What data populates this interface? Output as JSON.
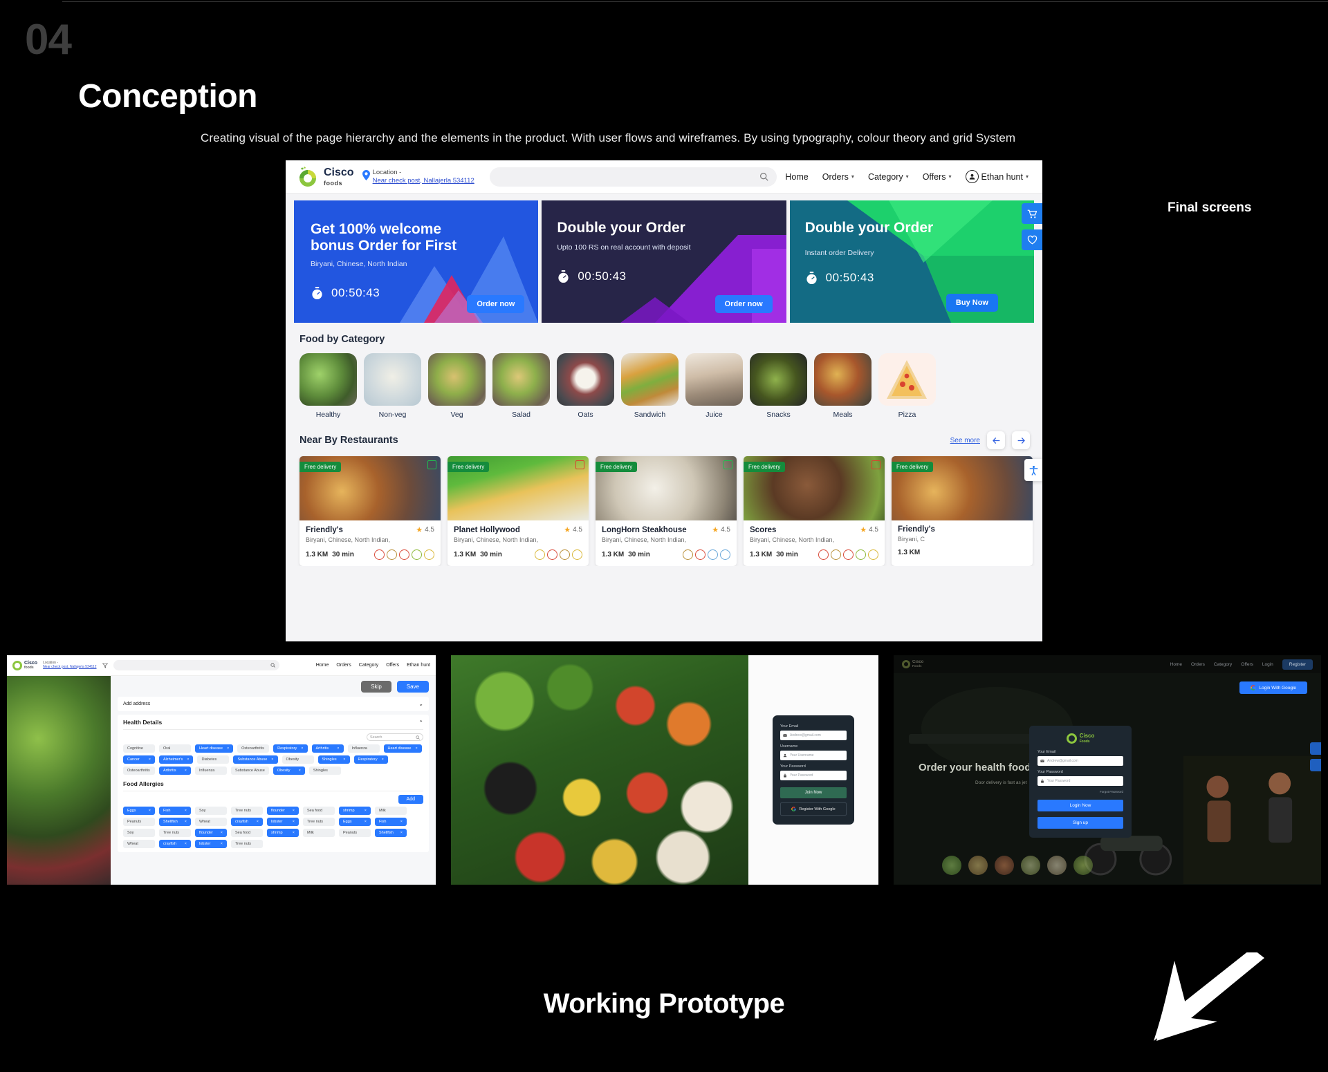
{
  "section": {
    "number": "04",
    "title": "Conception",
    "subtitle": "Creating visual of  the page hierarchy and the elements in the product. With user flows and wireframes. By using typography, colour theory and grid System",
    "final_screens_label": "Final screens",
    "footer_title": "Working Prototype"
  },
  "app": {
    "brand": {
      "name": "Cisco",
      "sub": "foods"
    },
    "location": {
      "label": "Location -",
      "value": "Near check post, Nallajerla  534112"
    },
    "search_placeholder": "",
    "nav": [
      {
        "label": "Home",
        "caret": false
      },
      {
        "label": "Orders",
        "caret": true
      },
      {
        "label": "Category",
        "caret": true
      },
      {
        "label": "Offers",
        "caret": true
      }
    ],
    "user": {
      "name": "Ethan hunt"
    }
  },
  "banners": [
    {
      "title": "Get 100% welcome bonus Order for First",
      "subtitle": "Biryani, Chinese, North Indian",
      "timer": "00:50:43",
      "cta": "Order now",
      "color": "#2256e0"
    },
    {
      "title": "Double your Order",
      "subtitle": "Upto 100 RS on real account with deposit",
      "timer": "00:50:43",
      "cta": "Order now",
      "color": "#272548"
    },
    {
      "title": "Double your Order",
      "subtitle": "Instant order Delivery",
      "timer": "00:50:43",
      "cta": "Buy Now",
      "color": "#136b84"
    }
  ],
  "category_section": {
    "heading": "Food by Category",
    "items": [
      {
        "label": "Healthy"
      },
      {
        "label": "Non-veg"
      },
      {
        "label": "Veg"
      },
      {
        "label": "Salad"
      },
      {
        "label": "Oats"
      },
      {
        "label": "Sandwich"
      },
      {
        "label": "Juice"
      },
      {
        "label": "Snacks"
      },
      {
        "label": "Meals"
      },
      {
        "label": "Pizza"
      }
    ]
  },
  "nearby": {
    "heading": "Near By Restaurants",
    "see_more": "See more",
    "restaurants": [
      {
        "badge": "Free delivery",
        "name": "Friendly's",
        "tags": "Biryani, Chinese, North Indian,",
        "distance": "1.3 KM",
        "time": "30 min",
        "rating": "4.5"
      },
      {
        "badge": "Free delivery",
        "name": "Planet Hollywood",
        "tags": "Biryani, Chinese, North Indian,",
        "distance": "1.3 KM",
        "time": "30 min",
        "rating": "4.5"
      },
      {
        "badge": "Free delivery",
        "name": "LongHorn Steakhouse",
        "tags": "Biryani, Chinese, North Indian,",
        "distance": "1.3 KM",
        "time": "30 min",
        "rating": "4.5"
      },
      {
        "badge": "Free delivery",
        "name": "Scores",
        "tags": "Biryani, Chinese, North Indian,",
        "distance": "1.3 KM",
        "time": "30 min",
        "rating": "4.5"
      },
      {
        "badge": "Free delivery",
        "name": "Friendly's",
        "tags": "Biryani, C",
        "distance": "1.3 KM",
        "time": "",
        "rating": ""
      }
    ]
  },
  "health_screen": {
    "skip": "Skip",
    "save": "Save",
    "add_address": "Add address",
    "health_details": "Health Details",
    "search_placeholder": "Search",
    "add_button": "Add",
    "food_allergies": "Food Allergies",
    "health_chips": [
      {
        "label": "Cognitive",
        "on": false
      },
      {
        "label": "Oral",
        "on": false
      },
      {
        "label": "Heart disease",
        "on": true
      },
      {
        "label": "Osteoarthritis",
        "on": false
      },
      {
        "label": "Respiratory",
        "on": true
      },
      {
        "label": "Arthritis",
        "on": true
      },
      {
        "label": "Influenza",
        "on": false
      },
      {
        "label": "Heart disease",
        "on": true
      },
      {
        "label": "Cancer",
        "on": true
      },
      {
        "label": "Alzheimer's",
        "on": true
      },
      {
        "label": "Diabetes",
        "on": false
      },
      {
        "label": "Substance Abuse",
        "on": true
      },
      {
        "label": "Obesity",
        "on": false
      },
      {
        "label": "Shingles",
        "on": true
      },
      {
        "label": "Respiratory",
        "on": true
      },
      {
        "label": "Osteoarthritis",
        "on": false
      },
      {
        "label": "Arthritis",
        "on": true
      },
      {
        "label": "Influenza",
        "on": false
      },
      {
        "label": "Substance Abuse",
        "on": false
      },
      {
        "label": "Obesity",
        "on": true
      },
      {
        "label": "Shingles",
        "on": false
      }
    ],
    "allergy_chips": [
      {
        "label": "Eggs",
        "on": true
      },
      {
        "label": "Fish",
        "on": true
      },
      {
        "label": "Soy",
        "on": false
      },
      {
        "label": "Tree nuts",
        "on": false
      },
      {
        "label": "flounder",
        "on": true
      },
      {
        "label": "Sea food",
        "on": false
      },
      {
        "label": "shrimp",
        "on": true
      },
      {
        "label": "Milk",
        "on": false
      },
      {
        "label": "Peanuts",
        "on": false
      },
      {
        "label": "Shellfish",
        "on": true
      },
      {
        "label": "Wheat",
        "on": false
      },
      {
        "label": "crayfish",
        "on": true
      },
      {
        "label": "lobster",
        "on": true
      },
      {
        "label": "Tree nuts",
        "on": false
      },
      {
        "label": "Eggs",
        "on": true
      },
      {
        "label": "Fish",
        "on": true
      },
      {
        "label": "Soy",
        "on": false
      },
      {
        "label": "Tree nuts",
        "on": false
      },
      {
        "label": "flounder",
        "on": true
      },
      {
        "label": "Sea food",
        "on": false
      },
      {
        "label": "shrimp",
        "on": true
      },
      {
        "label": "Milk",
        "on": false
      },
      {
        "label": "Peanuts",
        "on": false
      },
      {
        "label": "Shellfish",
        "on": true
      },
      {
        "label": "Wheat",
        "on": false
      },
      {
        "label": "crayfish",
        "on": true
      },
      {
        "label": "lobster",
        "on": true
      },
      {
        "label": "Tree nuts",
        "on": false
      }
    ]
  },
  "signup_screen": {
    "email_label": "Your Email",
    "email_value": "Andrew@gmail.com",
    "username_label": "Username",
    "username_placeholder": "Your Username",
    "password_label": "Your Password",
    "password_placeholder": "Your Password",
    "join_button": "Join Now",
    "google_button": "Register With Google"
  },
  "login_screen": {
    "brand": {
      "name": "Cisco",
      "sub": "Foods"
    },
    "nav": [
      {
        "label": "Home",
        "caret": false
      },
      {
        "label": "Orders",
        "caret": true
      },
      {
        "label": "Category",
        "caret": true
      },
      {
        "label": "Offers",
        "caret": true
      },
      {
        "label": "Login",
        "caret": false
      }
    ],
    "register_button": "Register",
    "google_button": "Login With Google",
    "hero_title": "Order your health food with",
    "hero_sub": "Door delivery is fast as jet",
    "email_label": "Your Email",
    "email_value": "Andrew@gmail.com",
    "password_label": "Your Password",
    "password_placeholder": "Your Password",
    "forgot": "Forgot Password",
    "login_button": "Login Now",
    "signup_button": "Sign up"
  },
  "colors": {
    "accent_blue": "#2979ff",
    "brand_green": "#8cc63e",
    "badge_green": "#148c3c",
    "star": "#f5a623",
    "page_bg": "#000000"
  }
}
